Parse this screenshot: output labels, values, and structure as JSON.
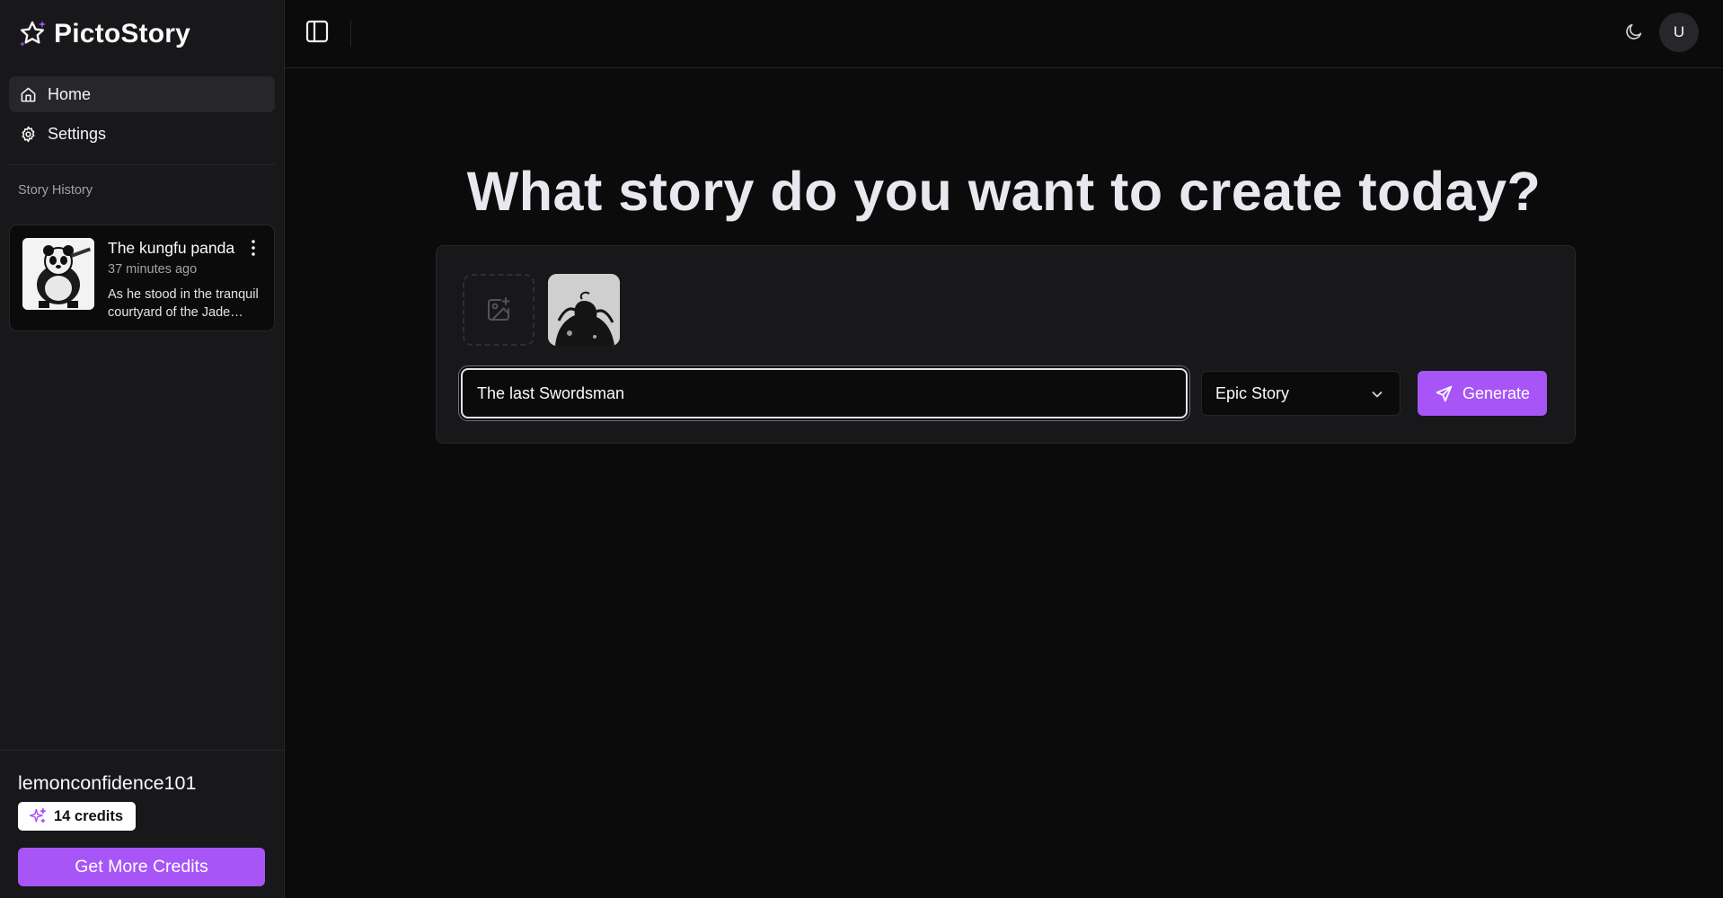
{
  "brand": {
    "name": "PictoStory",
    "logo_icon": "sparkle-star-icon",
    "accent": "#a855f7"
  },
  "sidebar": {
    "nav": [
      {
        "label": "Home",
        "icon": "home-icon",
        "active": true
      },
      {
        "label": "Settings",
        "icon": "gear-icon",
        "active": false
      }
    ],
    "history_label": "Story History",
    "history": [
      {
        "title": "The kungfu panda",
        "time": "37 minutes ago",
        "excerpt": "As he stood in the tranquil courtyard of the Jade Palace"
      }
    ],
    "user": {
      "name": "lemonconfidence101",
      "credits": "14 credits"
    },
    "more_credits_label": "Get More Credits"
  },
  "topbar": {
    "avatar_initial": "U"
  },
  "main": {
    "headline": "What story do you want to create today?",
    "prompt_value": "The last Swordsman",
    "story_type": "Epic Story",
    "generate_label": "Generate"
  }
}
